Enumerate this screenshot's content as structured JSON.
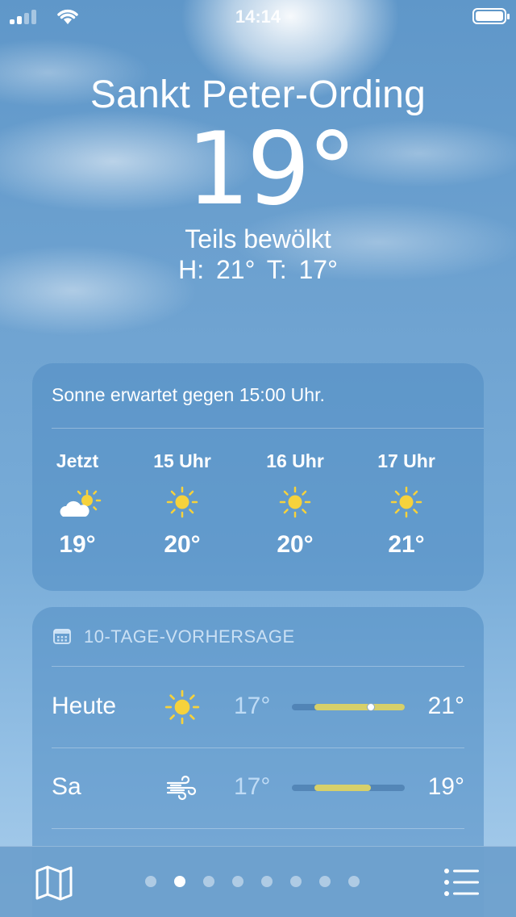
{
  "status_bar": {
    "time": "14:14"
  },
  "header": {
    "city": "Sankt Peter-Ording",
    "temperature": "19°",
    "condition": "Teils bewölkt",
    "high_low": "H: 21°  T: 17°"
  },
  "hourly": {
    "summary": "Sonne erwartet gegen 15:00 Uhr.",
    "items": [
      {
        "label": "Jetzt",
        "icon": "partly-cloudy-icon",
        "temp": "19°"
      },
      {
        "label": "15 Uhr",
        "icon": "sun-icon",
        "temp": "20°"
      },
      {
        "label": "16 Uhr",
        "icon": "sun-icon",
        "temp": "20°"
      },
      {
        "label": "17 Uhr",
        "icon": "sun-icon",
        "temp": "21°"
      }
    ]
  },
  "daily": {
    "title": "10-TAGE-VORHERSAGE",
    "days": [
      {
        "day": "Heute",
        "icon": "sun-icon",
        "low": "17°",
        "high": "21°",
        "range_start": 0.2,
        "range_end": 1.0,
        "current": 0.7
      },
      {
        "day": "Sa",
        "icon": "wind-icon",
        "low": "17°",
        "high": "19°",
        "range_start": 0.2,
        "range_end": 0.7
      }
    ]
  },
  "bottom_bar": {
    "page_count": 8,
    "active_page": 1
  },
  "colors": {
    "sun": "#f6d23c",
    "bar_fill": "#d7d06a"
  }
}
